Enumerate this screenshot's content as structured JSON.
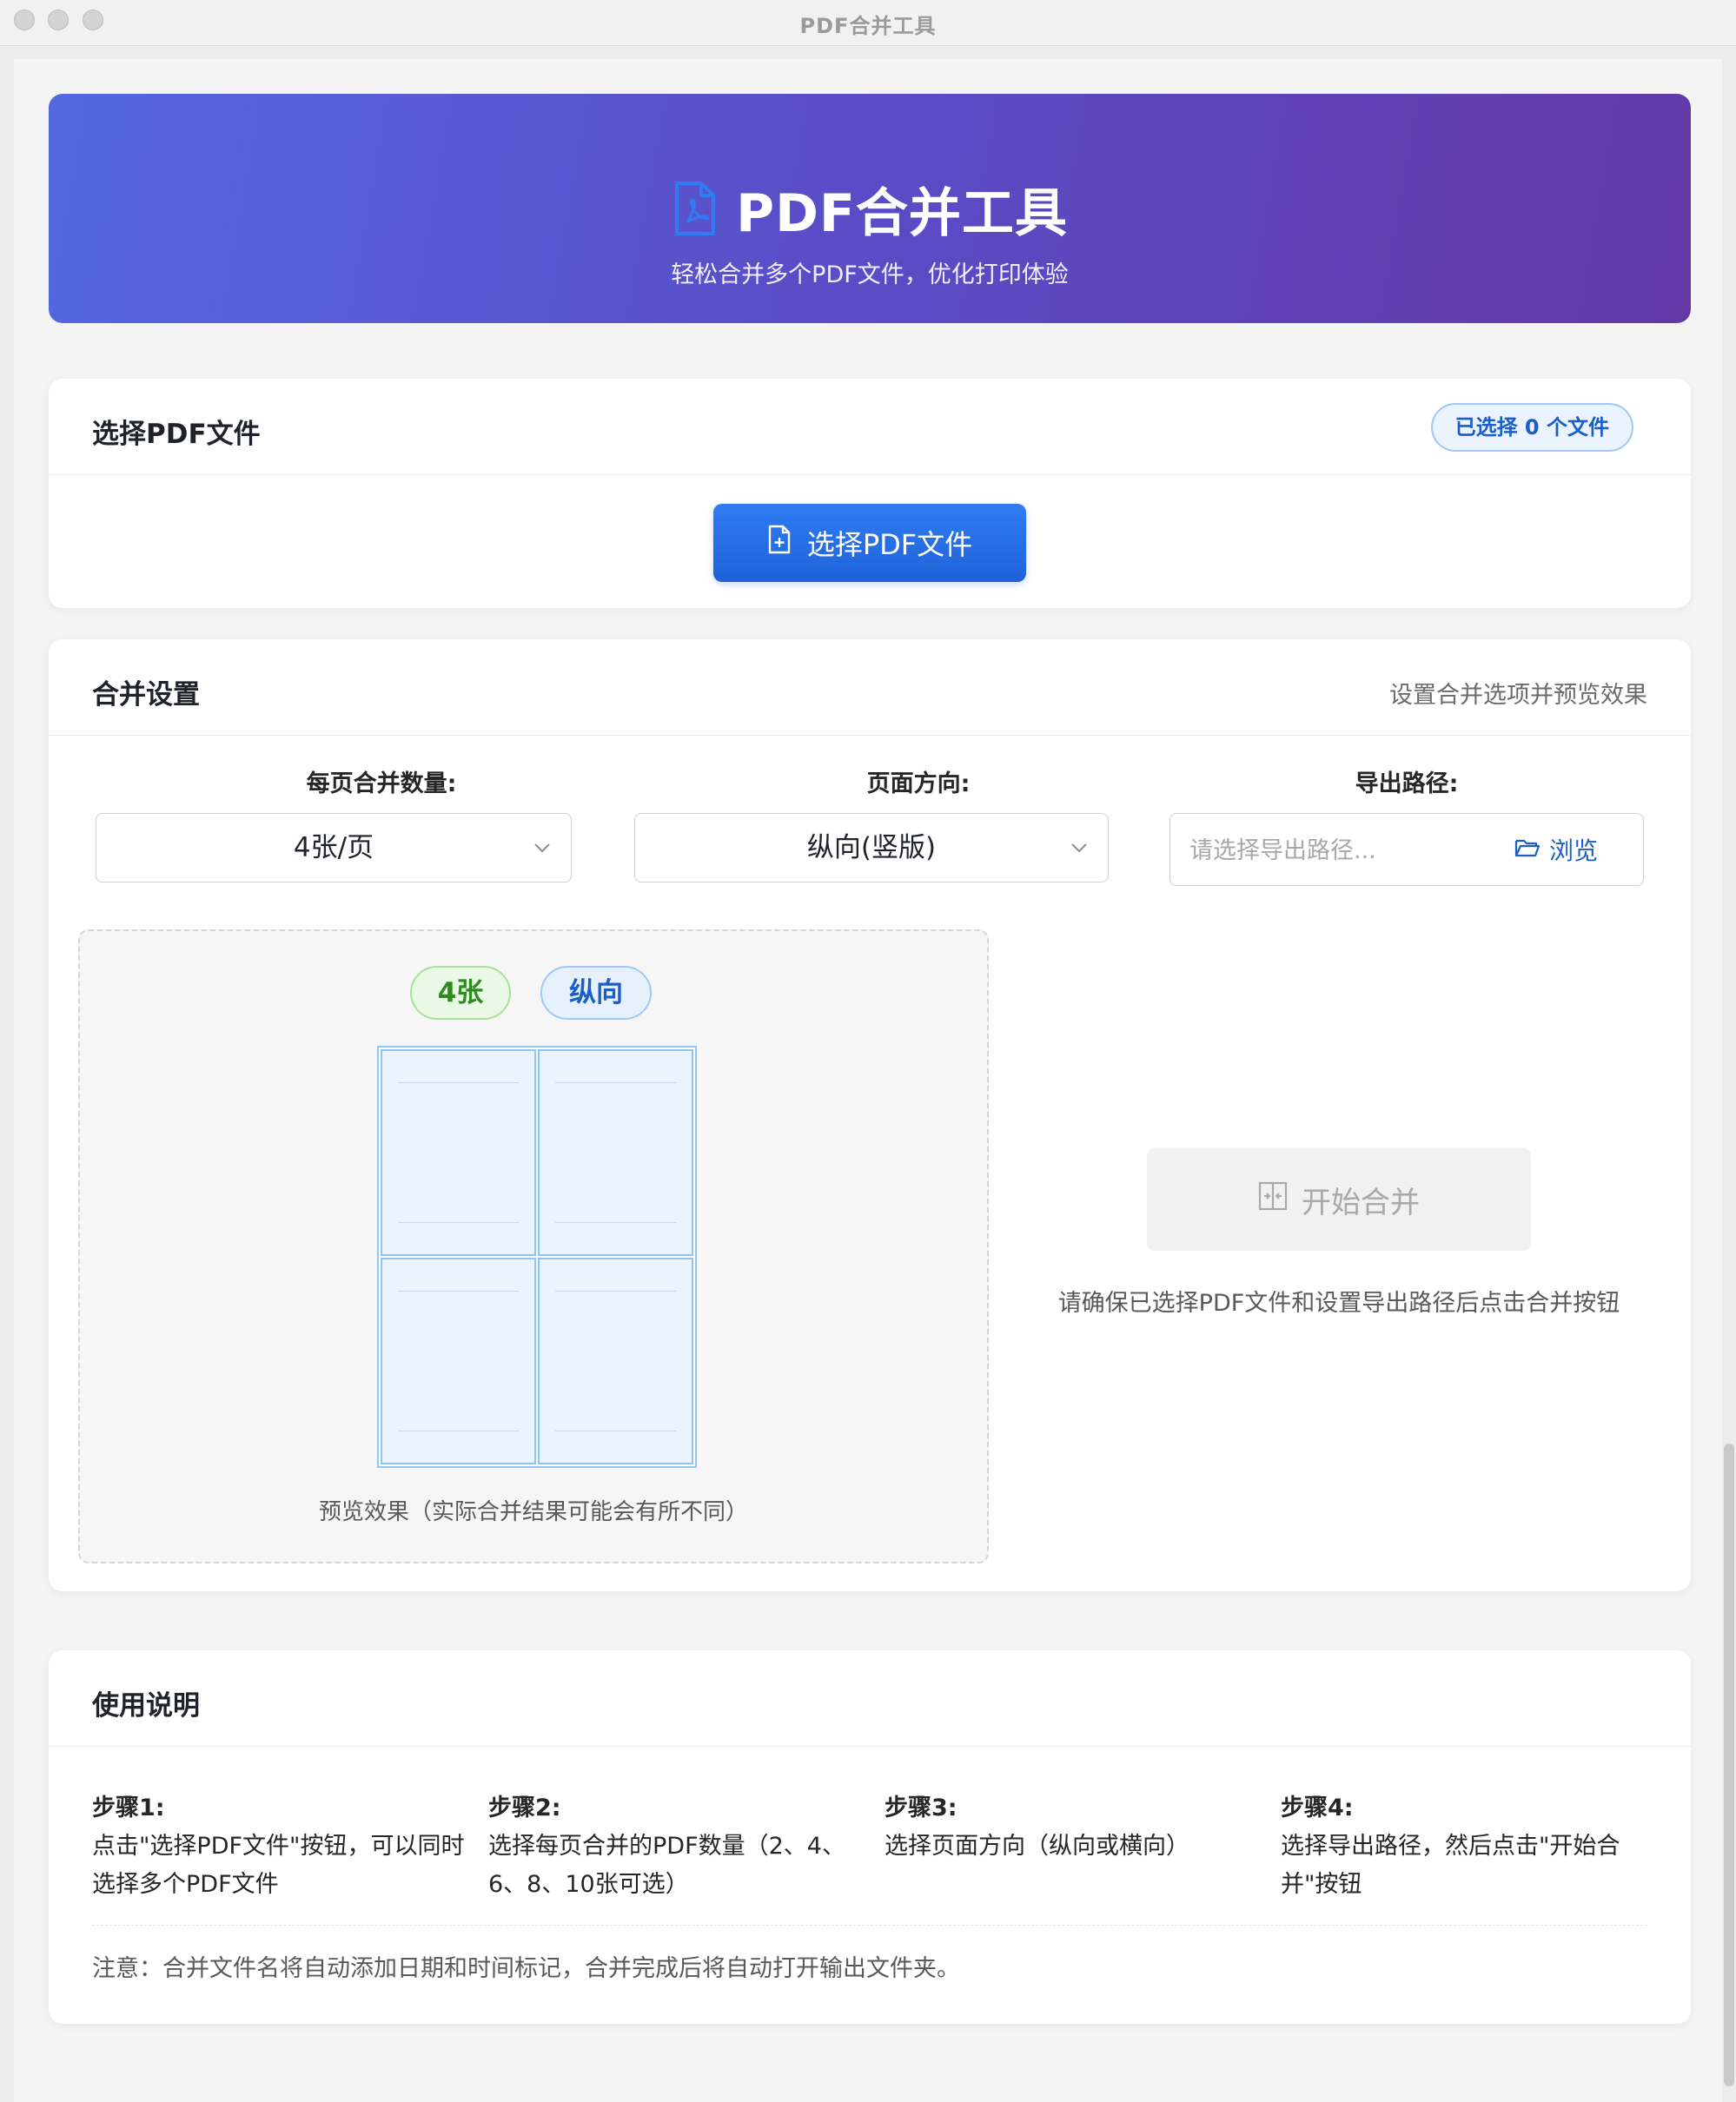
{
  "window": {
    "title": "PDF合并工具"
  },
  "hero": {
    "icon": "pdf-file-icon",
    "title": "PDF合并工具",
    "subtitle": "轻松合并多个PDF文件，优化打印体验"
  },
  "select_card": {
    "title": "选择PDF文件",
    "badge": "已选择 0 个文件",
    "button_label": "选择PDF文件",
    "button_icon": "file-add-icon"
  },
  "settings_card": {
    "title": "合并设置",
    "hint": "设置合并选项并预览效果",
    "per_page_label": "每页合并数量:",
    "per_page_value": "4张/页",
    "orientation_label": "页面方向:",
    "orientation_value": "纵向(竖版)",
    "export_label": "导出路径:",
    "export_placeholder": "请选择导出路径...",
    "browse_label": "浏览",
    "browse_icon": "folder-open-icon",
    "preview": {
      "count_pill": "4张",
      "orientation_pill": "纵向",
      "caption": "预览效果（实际合并结果可能会有所不同）",
      "pages_per_sheet": 4
    },
    "merge_button": "开始合并",
    "merge_icon": "merge-icon",
    "merge_hint": "请确保已选择PDF文件和设置导出路径后点击合并按钮"
  },
  "usage_card": {
    "title": "使用说明",
    "steps": [
      {
        "title": "步骤1:",
        "text": "点击\"选择PDF文件\"按钮，可以同时选择多个PDF文件"
      },
      {
        "title": "步骤2:",
        "text": "选择每页合并的PDF数量（2、4、6、8、10张可选）"
      },
      {
        "title": "步骤3:",
        "text": "选择页面方向（纵向或横向）"
      },
      {
        "title": "步骤4:",
        "text": "选择导出路径，然后点击\"开始合并\"按钮"
      }
    ],
    "note": "注意：合并文件名将自动添加日期和时间标记，合并完成后将自动打开输出文件夹。"
  },
  "colors": {
    "hero_gradient_start": "#5468e0",
    "hero_gradient_end": "#6538a6",
    "primary": "#1f62d8",
    "success": "#2e8b1f"
  }
}
